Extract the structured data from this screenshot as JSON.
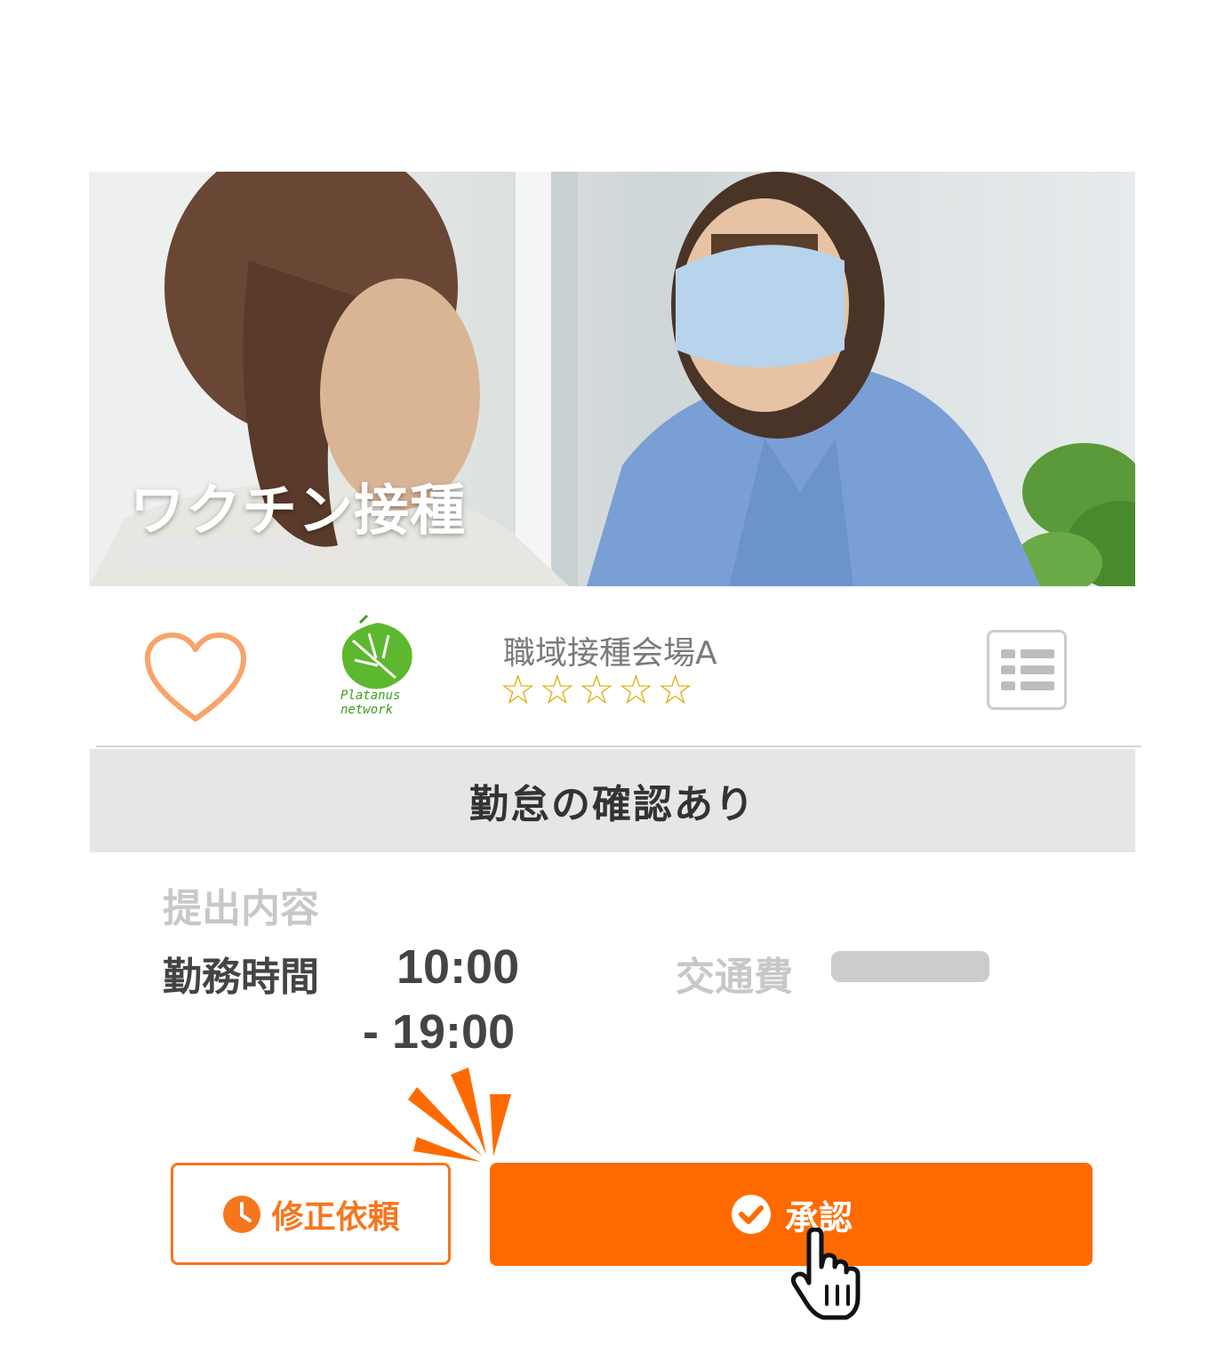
{
  "job": {
    "title": "ワクチン接種",
    "facility_name": "職域接種会場A",
    "rating_stars": "☆☆☆☆☆",
    "rating_value": 0,
    "rating_max": 5
  },
  "logo": {
    "line1": "Platanus",
    "line2": "network"
  },
  "status": {
    "label": "勤怠の確認あり"
  },
  "submission": {
    "section_label": "提出内容",
    "work_hours_label": "勤務時間",
    "start_time": "10:00",
    "end_time": "- 19:00",
    "transport_label": "交通費"
  },
  "actions": {
    "revise_label": "修正依頼",
    "approve_label": "承認"
  },
  "colors": {
    "accent": "#ff6a00",
    "heart": "#f9a36a",
    "star": "#e0ad0a",
    "logo": "#3ca01e"
  }
}
